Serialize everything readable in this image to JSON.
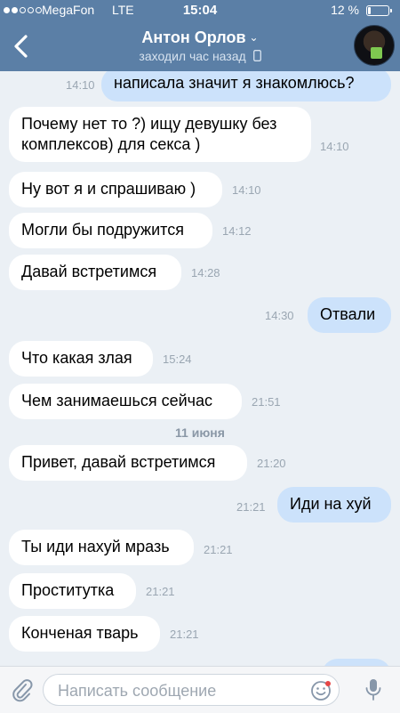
{
  "status_bar": {
    "carrier": "MegaFon",
    "network": "LTE",
    "time": "15:04",
    "battery": "12 %",
    "battery_level": 0.12,
    "signal_strength": 2
  },
  "header": {
    "title": "Антон Орлов",
    "subtitle": "заходил час назад",
    "back_icon": "chevron-left-icon",
    "avatar": "contact-avatar"
  },
  "messages": [
    {
      "dir": "out",
      "text": "написала значит я знакомлюсь?",
      "time": "14:10"
    },
    {
      "dir": "in",
      "text": "Почему нет то ?) ищу девушку без комплексов) для секса )",
      "time": "14:10"
    },
    {
      "dir": "in",
      "text": "Ну вот я и спрашиваю )",
      "time": "14:10"
    },
    {
      "dir": "in",
      "text": "Могли бы подружится",
      "time": "14:12"
    },
    {
      "dir": "in",
      "text": "Давай встретимся",
      "time": "14:28"
    },
    {
      "dir": "out",
      "text": "Отвали",
      "time": "14:30"
    },
    {
      "dir": "in",
      "text": "Что какая злая",
      "time": "15:24"
    },
    {
      "dir": "in",
      "text": "Чем занимаешься сейчас",
      "time": "21:51"
    },
    {
      "dir": "in",
      "text": "Привет, давай встретимся",
      "time": "21:20"
    },
    {
      "dir": "out",
      "text": "Иди на хуй",
      "time": "21:21"
    },
    {
      "dir": "in",
      "text": "Ты иди нахуй мразь",
      "time": "21:21"
    },
    {
      "dir": "in",
      "text": "Проститутка",
      "time": "21:21"
    },
    {
      "dir": "in",
      "text": "Конченая тварь",
      "time": "21:21"
    }
  ],
  "date_separator": "11 июня",
  "composer": {
    "placeholder": "Написать сообщение",
    "attach_icon": "paperclip-icon",
    "emoji_icon": "smile-icon",
    "mic_icon": "microphone-icon"
  },
  "colors": {
    "header_bg": "#5b7fa6",
    "chat_bg": "#ebf0f5",
    "incoming_bubble": "#ffffff",
    "outgoing_bubble": "#cce2fb",
    "time_text": "#9aa6b2"
  }
}
